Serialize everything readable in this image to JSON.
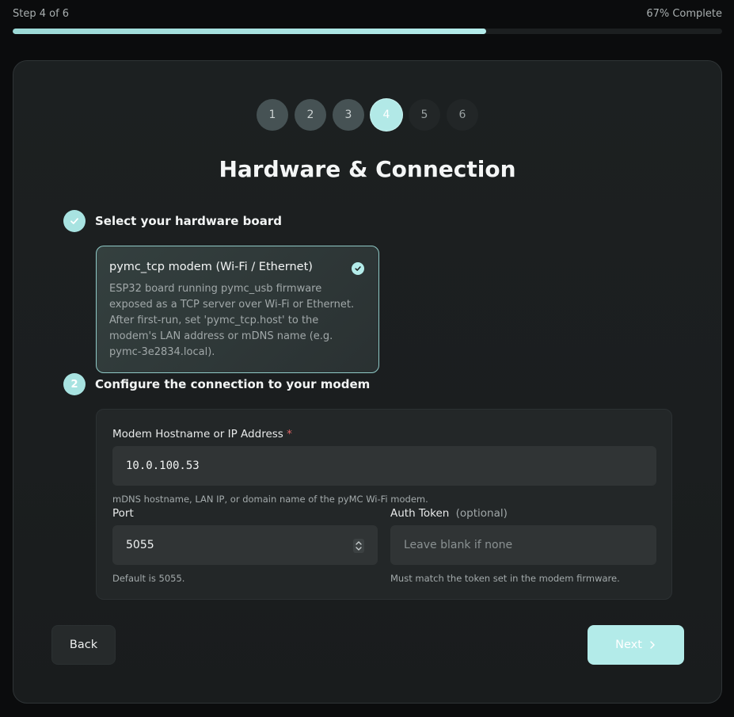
{
  "progress": {
    "step_label": "Step 4 of 6",
    "percent_label": "67% Complete",
    "fraction": 0.667
  },
  "stepper": {
    "steps": [
      {
        "label": "1",
        "state": "done"
      },
      {
        "label": "2",
        "state": "done"
      },
      {
        "label": "3",
        "state": "done"
      },
      {
        "label": "4",
        "state": "active"
      },
      {
        "label": "5",
        "state": "pending"
      },
      {
        "label": "6",
        "state": "pending"
      }
    ]
  },
  "title": "Hardware & Connection",
  "section1": {
    "heading": "Select your hardware board",
    "board": {
      "title": "pymc_tcp modem (Wi-Fi / Ethernet)",
      "description": "ESP32 board running pymc_usb firmware exposed as a TCP server over Wi-Fi or Ethernet. After first-run, set 'pymc_tcp.host' to the modem's LAN address or mDNS name (e.g. pymc-3e2834.local)."
    }
  },
  "section2": {
    "number": "2",
    "heading": "Configure the connection to your modem",
    "host": {
      "label": "Modem Hostname or IP Address",
      "required_mark": "*",
      "value": "10.0.100.53",
      "hint": "mDNS hostname, LAN IP, or domain name of the pyMC Wi-Fi modem."
    },
    "port": {
      "label": "Port",
      "value": "5055",
      "hint": "Default is 5055."
    },
    "token": {
      "label": "Auth Token",
      "optional": "(optional)",
      "placeholder": "Leave blank if none",
      "hint": "Must match the token set in the modem firmware."
    }
  },
  "buttons": {
    "back": "Back",
    "next": "Next"
  },
  "colors": {
    "accent": "#b3ebe9",
    "background": "#0b0c0d",
    "card": "#1c2021",
    "required": "#e06565"
  }
}
